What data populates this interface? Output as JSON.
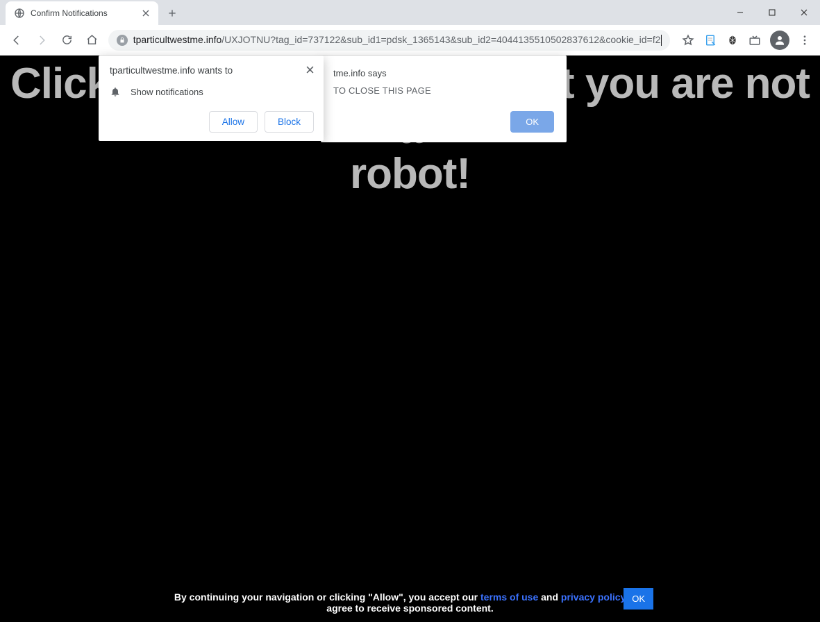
{
  "window": {
    "minimize_icon": "minimize-icon",
    "maximize_icon": "maximize-icon",
    "close_icon": "close-icon"
  },
  "tab": {
    "title": "Confirm Notifications",
    "favicon": "globe-icon"
  },
  "url": {
    "host": "tparticultwestme.info",
    "path": "/UXJOTNU?tag_id=737122&sub_id1=pdsk_1365143&sub_id2=4044135510502837612&cookie_id=f2",
    "suffix": "…"
  },
  "permission": {
    "prompt": "tparticultwestme.info wants to",
    "row": "Show notifications",
    "allow": "Allow",
    "block": "Block"
  },
  "alert": {
    "title": "tme.info says",
    "body": "TO CLOSE THIS PAGE",
    "ok": "OK"
  },
  "hero": {
    "line1": "Click \"Allow\" to confirm that you are not a",
    "line2": "robot!"
  },
  "cookie": {
    "prefix": "By continuing your navigation or clicking \"Allow\", you accept our ",
    "terms": "terms of use",
    "mid": " and ",
    "privacy": "privacy policy",
    "suffix": " and",
    "line2": "agree to receive sponsored content.",
    "ok": "OK"
  }
}
